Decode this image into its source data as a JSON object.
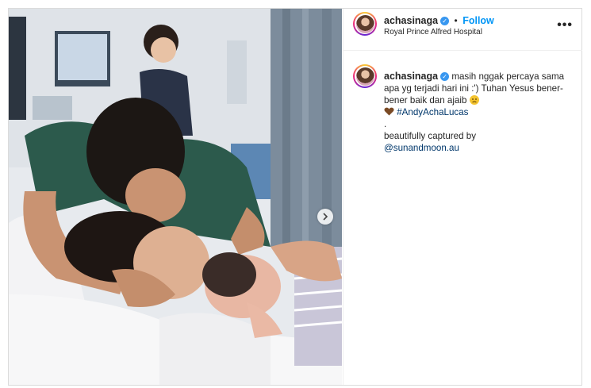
{
  "post": {
    "username": "achasinaga",
    "follow_label": "Follow",
    "separator": "•",
    "location": "Royal Prince Alfred Hospital",
    "more_label": "•••"
  },
  "caption": {
    "username": "achasinaga",
    "text_1": "masih nggak percaya sama apa yg terjadi hari ini :') Tuhan Yesus bener-bener baik dan ajaib",
    "hashtag": "#AndyAchaLucas",
    "dot": ".",
    "credit_text": "beautifully captured by",
    "credit_handle": "@sunandmoon.au"
  },
  "icons": {
    "verified": "verified-badge-icon",
    "sad_face": "sad-face-emoji",
    "brown_heart": "brown-heart-emoji",
    "carousel_next": "chevron-right-icon"
  },
  "colors": {
    "link_blue": "#0095f6",
    "hashtag_blue": "#00376b",
    "verified_blue": "#3897f0",
    "border": "#dbdbdb"
  }
}
